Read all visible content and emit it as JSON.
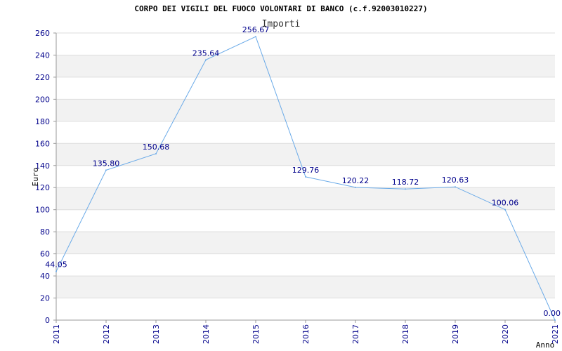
{
  "chart_data": {
    "type": "line",
    "title": "CORPO DEI VIGILI DEL FUOCO VOLONTARI DI BANCO (c.f.92003010227)",
    "series_title": "Importi",
    "xlabel": "Anno",
    "ylabel": "Euro",
    "categories": [
      "2011",
      "2012",
      "2013",
      "2014",
      "2015",
      "2016",
      "2017",
      "2018",
      "2019",
      "2020",
      "2021"
    ],
    "series": [
      {
        "name": "Importi",
        "values": [
          44.05,
          135.8,
          150.68,
          235.64,
          256.67,
          129.76,
          120.22,
          118.72,
          120.63,
          100.06,
          0.0
        ]
      }
    ],
    "data_labels": [
      "44.05",
      "135.80",
      "150.68",
      "235.64",
      "256.67",
      "129.76",
      "120.22",
      "118.72",
      "120.63",
      "100.06",
      "0.00"
    ],
    "ylim": [
      0,
      260
    ],
    "yticks": [
      0,
      20,
      40,
      60,
      80,
      100,
      120,
      140,
      160,
      180,
      200,
      220,
      240,
      260
    ],
    "grid": true,
    "line_color": "#6aaae8",
    "band_color": "#f2f2f2",
    "grid_color": "#dddddd",
    "tick_color": "#00008b"
  }
}
